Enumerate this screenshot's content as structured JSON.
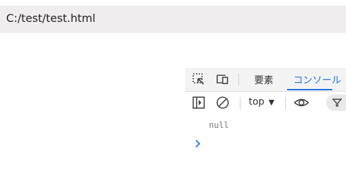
{
  "address_bar": {
    "url": "C:/test/test.html"
  },
  "devtools": {
    "tabs": [
      {
        "label": "要素"
      },
      {
        "label": "コンソール",
        "active": true
      }
    ],
    "toolbar": {
      "context": "top"
    },
    "console": {
      "output": "null"
    },
    "accent_color": "#1a73e8"
  }
}
